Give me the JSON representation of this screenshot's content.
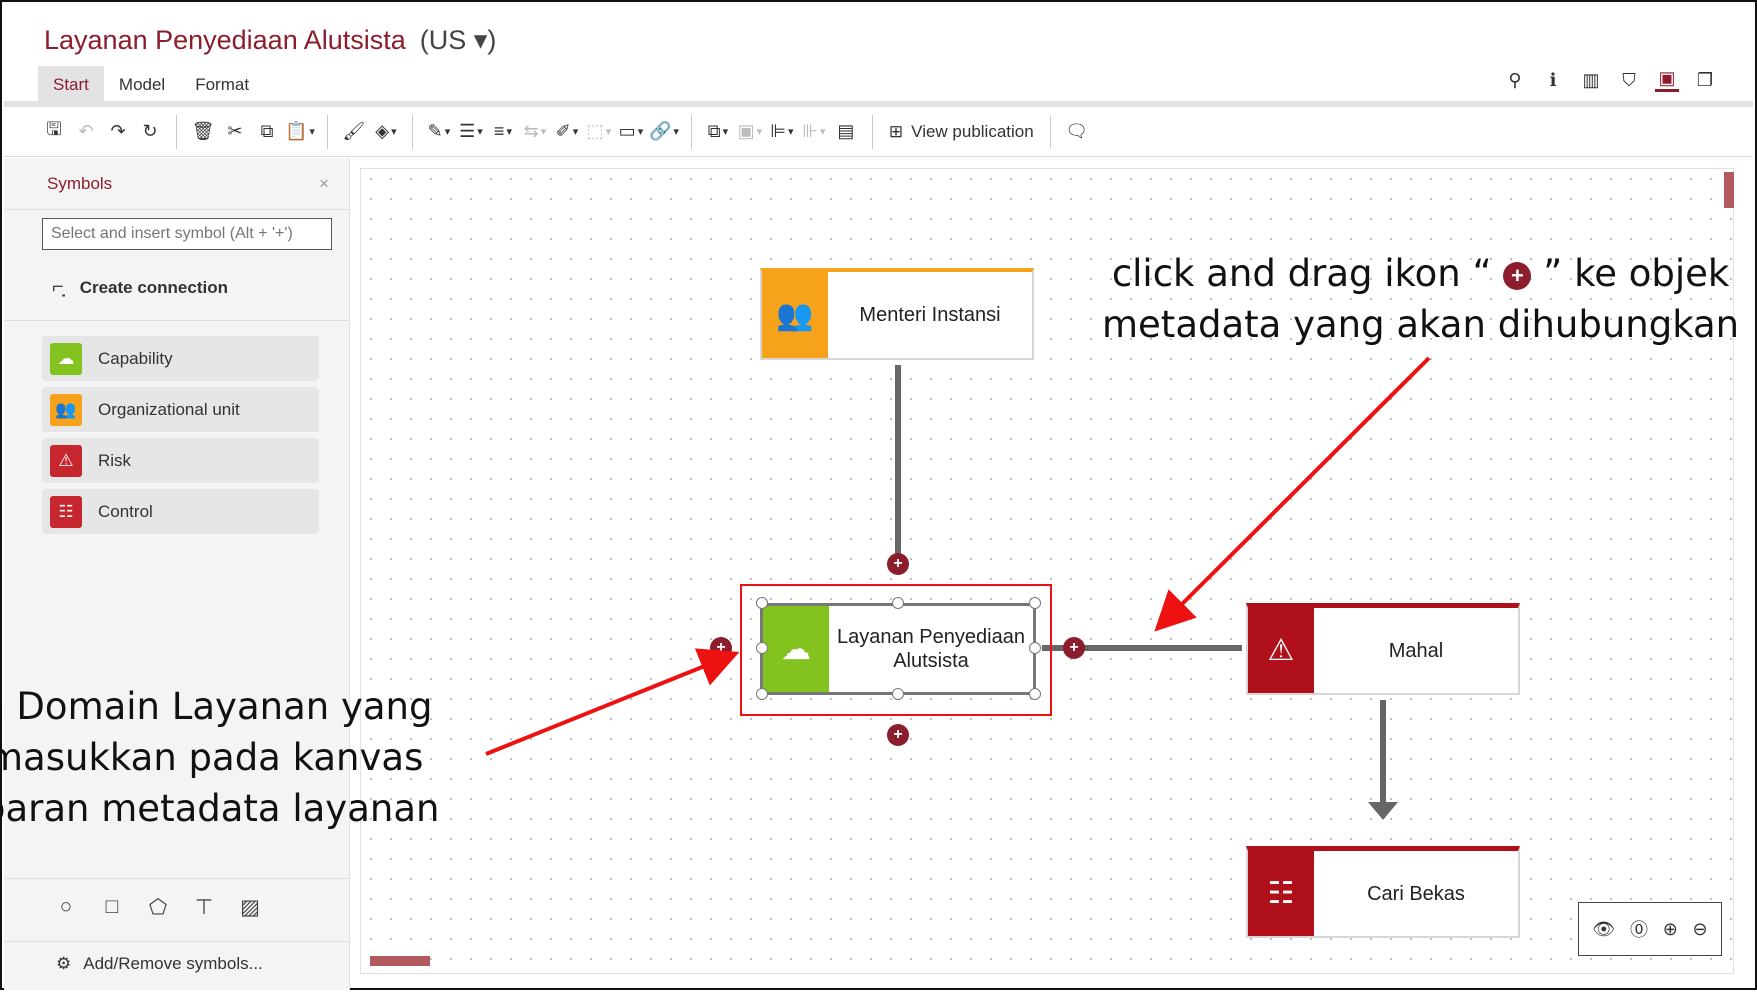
{
  "app": {
    "title": "Layanan Penyediaan Alutsista",
    "language": "(US ▾)"
  },
  "tabs": [
    {
      "label": "Start",
      "active": true
    },
    {
      "label": "Model",
      "active": false
    },
    {
      "label": "Format",
      "active": false
    }
  ],
  "header_icons": [
    "search-icon",
    "info-icon",
    "bar-chart-icon",
    "shield-icon",
    "model-view-icon",
    "comments-icon"
  ],
  "toolbar": {
    "view_publication_label": "View publication"
  },
  "sidebar": {
    "title": "Symbols",
    "close": "×",
    "search_placeholder": "Select and insert symbol (Alt + '+')",
    "create_connection": "Create connection",
    "symbols": [
      {
        "label": "Capability",
        "color": "#84c31f",
        "icon": "capability-icon"
      },
      {
        "label": "Organizational unit",
        "color": "#f7a21b",
        "icon": "org-unit-icon"
      },
      {
        "label": "Risk",
        "color": "#c6262e",
        "icon": "risk-icon"
      },
      {
        "label": "Control",
        "color": "#c6262e",
        "icon": "control-icon"
      }
    ],
    "add_remove": "Add/Remove symbols..."
  },
  "canvas": {
    "nodes": [
      {
        "label": "Menteri Instansi",
        "type": "organizational-unit",
        "color": "#f7a21b"
      },
      {
        "label": "Layanan Penyediaan Alutsista",
        "type": "capability",
        "color": "#84c31f",
        "selected": true
      },
      {
        "label": "Mahal",
        "type": "risk",
        "color": "#b0101a"
      },
      {
        "label": "Cari Bekas",
        "type": "control",
        "color": "#b0101a"
      }
    ]
  },
  "annotations": {
    "right_line1_a": "click and drag ikon “ ",
    "right_line1_b": " ” ke objek",
    "right_line2": "metadata yang akan dihubungkan",
    "left_line1": "a Domain Layanan yang",
    "left_line2": "masukkan pada kanvas",
    "left_line3": "baran metadata layanan"
  },
  "colors": {
    "accent": "#8c1d2d",
    "arrow": "#ee1111",
    "connector": "#666666"
  }
}
